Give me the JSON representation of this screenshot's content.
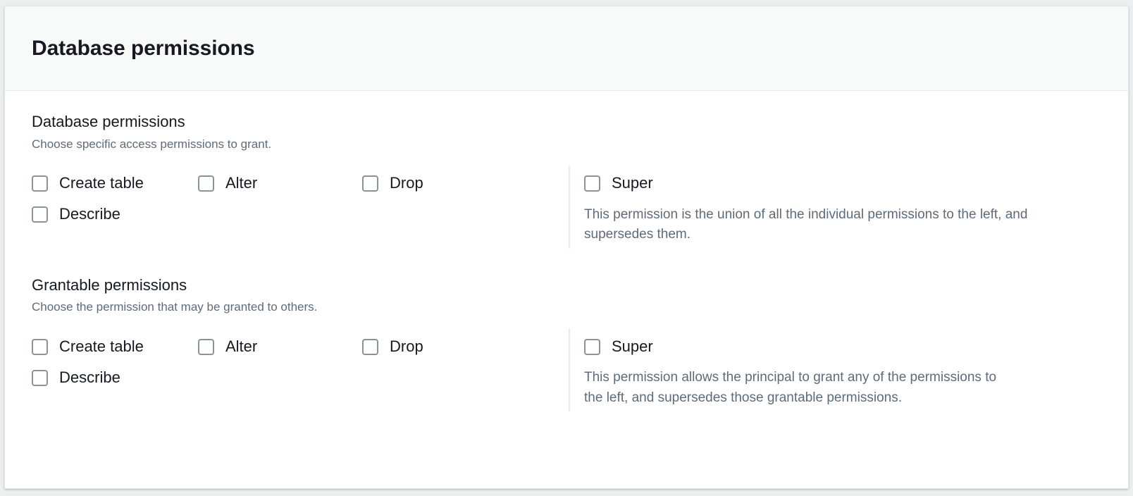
{
  "card": {
    "title": "Database permissions"
  },
  "sections": [
    {
      "heading": "Database permissions",
      "description": "Choose specific access permissions to grant.",
      "permissions": [
        {
          "label": "Create table",
          "checked": false
        },
        {
          "label": "Alter",
          "checked": false
        },
        {
          "label": "Drop",
          "checked": false
        },
        {
          "label": "Describe",
          "checked": false
        }
      ],
      "super": {
        "label": "Super",
        "checked": false,
        "description": "This permission is the union of all the individual permissions to the left, and supersedes them."
      }
    },
    {
      "heading": "Grantable permissions",
      "description": "Choose the permission that may be granted to others.",
      "permissions": [
        {
          "label": "Create table",
          "checked": false
        },
        {
          "label": "Alter",
          "checked": false
        },
        {
          "label": "Drop",
          "checked": false
        },
        {
          "label": "Describe",
          "checked": false
        }
      ],
      "super": {
        "label": "Super",
        "checked": false,
        "description": "This permission allows the principal to grant any of the permissions to the left, and supersedes those grantable permissions."
      }
    }
  ],
  "colors": {
    "page_background": "#eceff0",
    "card_background": "#ffffff",
    "header_background": "#f8f9f9",
    "heading_text": "#16191f",
    "muted_text": "#5f6b7a",
    "checkbox_border": "#879596",
    "divider": "#eaedef"
  }
}
